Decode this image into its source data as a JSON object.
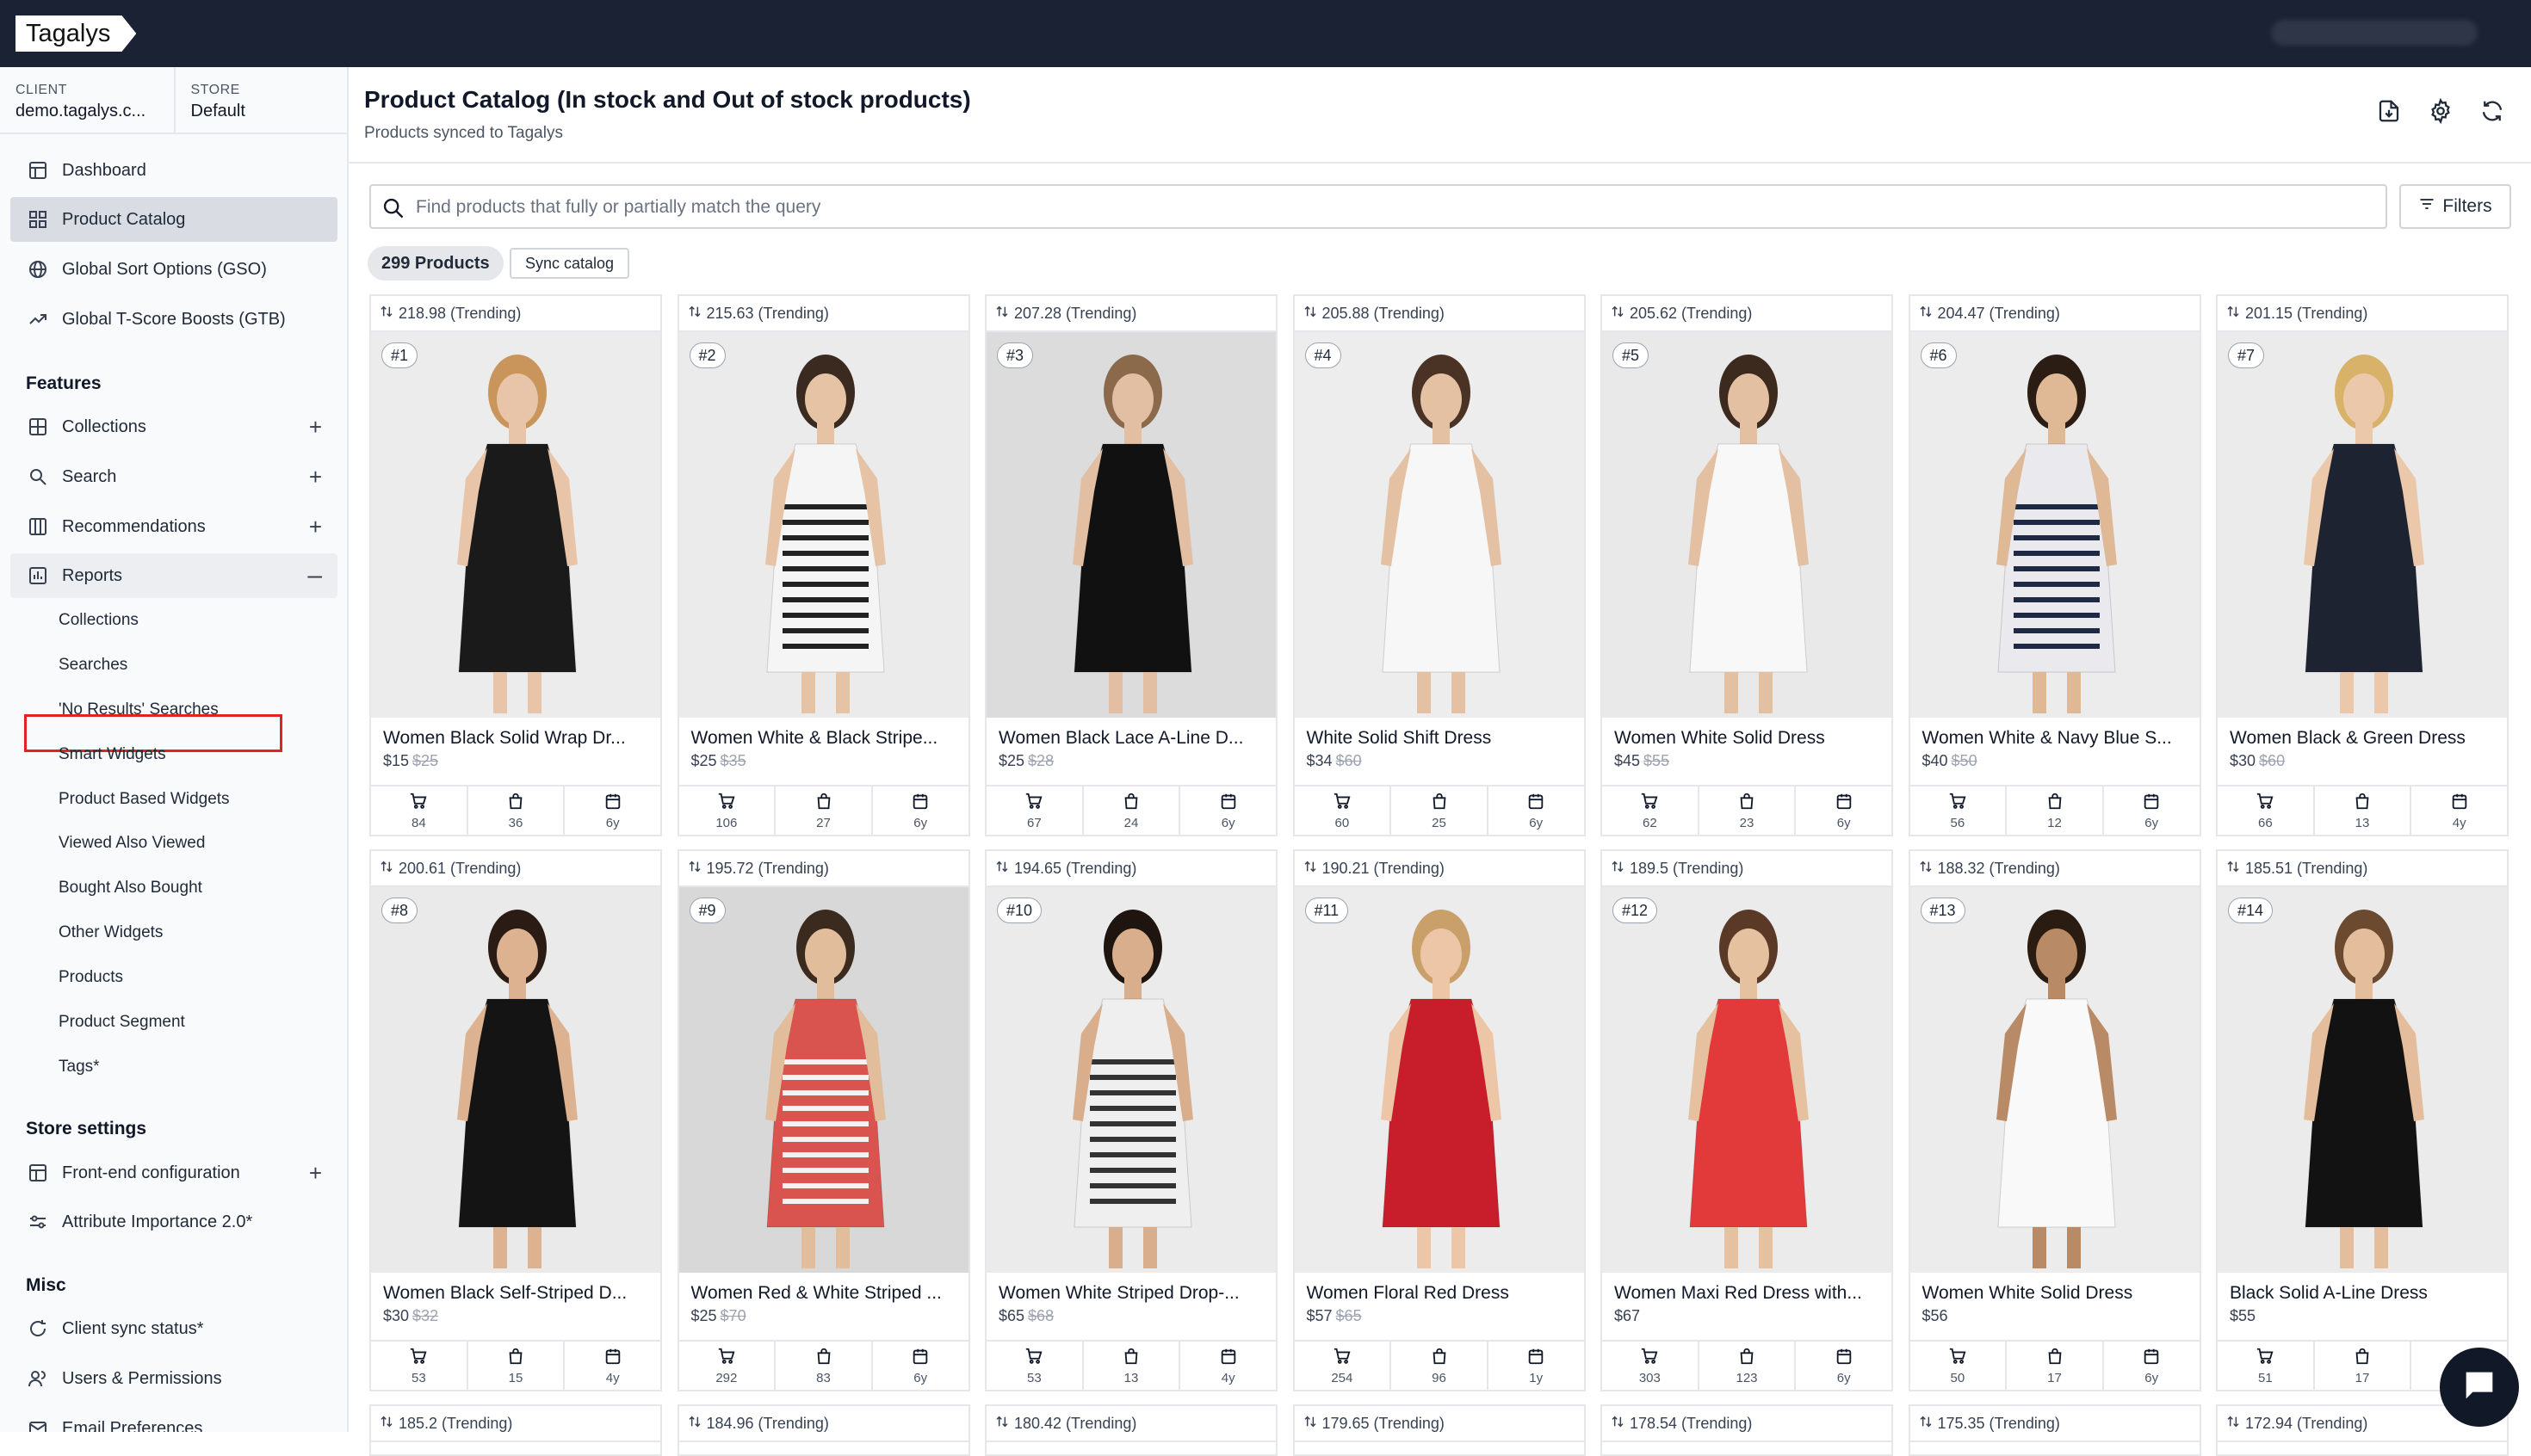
{
  "app": {
    "logo": "Tagalys"
  },
  "client_store": {
    "client_label": "CLIENT",
    "client_value": "demo.tagalys.c...",
    "store_label": "STORE",
    "store_value": "Default"
  },
  "nav": {
    "dashboard": "Dashboard",
    "product_catalog": "Product Catalog",
    "gso": "Global Sort Options (GSO)",
    "gtb": "Global T-Score Boosts (GTB)",
    "features_title": "Features",
    "collections": "Collections",
    "search": "Search",
    "recommendations": "Recommendations",
    "reports": "Reports",
    "reports_sub": [
      "Collections",
      "Searches",
      "'No Results' Searches",
      "Smart Widgets",
      "Product Based Widgets",
      "Viewed Also Viewed",
      "Bought Also Bought",
      "Other Widgets",
      "Products",
      "Product Segment",
      "Tags*"
    ],
    "store_settings_title": "Store settings",
    "frontend_config": "Front-end configuration",
    "attribute_importance": "Attribute Importance 2.0*",
    "misc_title": "Misc",
    "client_sync": "Client sync status*",
    "users_permissions": "Users & Permissions",
    "email_prefs": "Email Preferences"
  },
  "header": {
    "title": "Product Catalog (In stock and Out of stock products)",
    "subtitle": "Products synced to Tagalys"
  },
  "search": {
    "placeholder": "Find products that fully or partially match the query"
  },
  "toolbar": {
    "filters": "Filters",
    "count": "299 Products",
    "sync": "Sync catalog"
  },
  "products": [
    {
      "score": "218.98 (Trending)",
      "rank": "#1",
      "name": "Women Black Solid Wrap Dr...",
      "price": "$15",
      "old": "$25",
      "s1": "84",
      "s2": "36",
      "s3": "6y",
      "dress": "#1a1a1a",
      "bg": "#ececec",
      "skin": "#e8c5a8",
      "hair": "#c9955b"
    },
    {
      "score": "215.63 (Trending)",
      "rank": "#2",
      "name": "Women White & Black Stripe...",
      "price": "$25",
      "old": "$35",
      "s1": "106",
      "s2": "27",
      "s3": "6y",
      "dress": "#f5f5f5",
      "bg": "#ebebeb",
      "skin": "#e6c3a5",
      "hair": "#3a2a20",
      "stripe": "#222222"
    },
    {
      "score": "207.28 (Trending)",
      "rank": "#3",
      "name": "Women Black Lace A-Line D...",
      "price": "$25",
      "old": "$28",
      "s1": "67",
      "s2": "24",
      "s3": "6y",
      "dress": "#111111",
      "bg": "#dcdcdc",
      "skin": "#e2bfa2",
      "hair": "#8a6a4a"
    },
    {
      "score": "205.88 (Trending)",
      "rank": "#4",
      "name": "White Solid Shift Dress",
      "price": "$34",
      "old": "$60",
      "s1": "60",
      "s2": "25",
      "s3": "6y",
      "dress": "#f7f7f7",
      "bg": "#ededed",
      "skin": "#e5c1a3",
      "hair": "#4a3324"
    },
    {
      "score": "205.62 (Trending)",
      "rank": "#5",
      "name": "Women White Solid Dress",
      "price": "$45",
      "old": "$55",
      "s1": "62",
      "s2": "23",
      "s3": "6y",
      "dress": "#f8f8f8",
      "bg": "#e9e9e9",
      "skin": "#e4c0a2",
      "hair": "#3d2a1e"
    },
    {
      "score": "204.47 (Trending)",
      "rank": "#6",
      "name": "Women White & Navy Blue S...",
      "price": "$40",
      "old": "$50",
      "s1": "56",
      "s2": "12",
      "s3": "6y",
      "dress": "#e9e9ee",
      "bg": "#ececec",
      "skin": "#dfb896",
      "hair": "#2b1d14",
      "stripe": "#1e2a44"
    },
    {
      "score": "201.15 (Trending)",
      "rank": "#7",
      "name": "Women Black & Green Dress",
      "price": "$30",
      "old": "$60",
      "s1": "66",
      "s2": "13",
      "s3": "4y",
      "dress": "#1d2330",
      "bg": "#ebebeb",
      "skin": "#ecc8aa",
      "hair": "#d9b26a"
    },
    {
      "score": "200.61 (Trending)",
      "rank": "#8",
      "name": "Women Black Self-Striped D...",
      "price": "$30",
      "old": "$32",
      "s1": "53",
      "s2": "15",
      "s3": "4y",
      "dress": "#141414",
      "bg": "#eaeaea",
      "skin": "#dcb290",
      "hair": "#2a1c14"
    },
    {
      "score": "195.72 (Trending)",
      "rank": "#9",
      "name": "Women Red & White Striped ...",
      "price": "$25",
      "old": "$70",
      "s1": "292",
      "s2": "83",
      "s3": "6y",
      "dress": "#d9534f",
      "bg": "#d8d8d8",
      "skin": "#e2bd9c",
      "hair": "#3b2a1e",
      "stripe": "#f3f3f3"
    },
    {
      "score": "194.65 (Trending)",
      "rank": "#10",
      "name": "Women White Striped Drop-...",
      "price": "$65",
      "old": "$68",
      "s1": "53",
      "s2": "13",
      "s3": "4y",
      "dress": "#efefef",
      "bg": "#ebebeb",
      "skin": "#d8ae8c",
      "hair": "#1f1510",
      "stripe": "#333333"
    },
    {
      "score": "190.21 (Trending)",
      "rank": "#11",
      "name": "Women Floral Red Dress",
      "price": "$57",
      "old": "$65",
      "s1": "254",
      "s2": "96",
      "s3": "1y",
      "dress": "#c81d2a",
      "bg": "#ececec",
      "skin": "#ecc6a6",
      "hair": "#caa06a"
    },
    {
      "score": "189.5 (Trending)",
      "rank": "#12",
      "name": "Women Maxi Red Dress with...",
      "price": "$67",
      "old": "",
      "s1": "303",
      "s2": "123",
      "s3": "6y",
      "dress": "#e23a3a",
      "bg": "#ebebeb",
      "skin": "#e6c1a0",
      "hair": "#5a3a26"
    },
    {
      "score": "188.32 (Trending)",
      "rank": "#13",
      "name": "Women White Solid Dress",
      "price": "$56",
      "old": "",
      "s1": "50",
      "s2": "17",
      "s3": "6y",
      "dress": "#f9f9f9",
      "bg": "#ececec",
      "skin": "#b98a66",
      "hair": "#2b1c12"
    },
    {
      "score": "185.51 (Trending)",
      "rank": "#14",
      "name": "Black Solid A-Line Dress",
      "price": "$55",
      "old": "",
      "s1": "51",
      "s2": "17",
      "s3": "",
      "dress": "#121212",
      "bg": "#ebebeb",
      "skin": "#e4bd9c",
      "hair": "#6b4a30"
    }
  ],
  "next_row_scores": [
    "185.2 (Trending)",
    "184.96 (Trending)",
    "180.42 (Trending)",
    "179.65 (Trending)",
    "178.54 (Trending)",
    "175.35 (Trending)",
    "172.94 (Trending)"
  ]
}
